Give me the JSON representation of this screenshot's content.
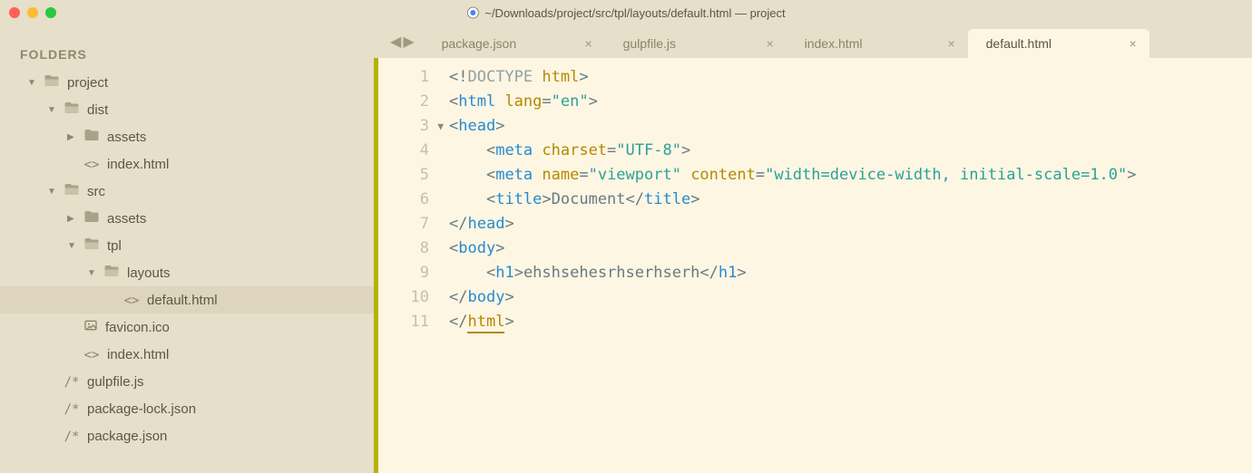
{
  "titlebar": {
    "path": "~/Downloads/project/src/tpl/layouts/default.html — project"
  },
  "sidebar": {
    "title": "FOLDERS",
    "tree": [
      {
        "depth": 0,
        "type": "folder",
        "open": true,
        "name": "project"
      },
      {
        "depth": 1,
        "type": "folder",
        "open": true,
        "name": "dist"
      },
      {
        "depth": 2,
        "type": "folder",
        "open": false,
        "name": "assets"
      },
      {
        "depth": 2,
        "type": "file",
        "icon": "code",
        "name": "index.html"
      },
      {
        "depth": 1,
        "type": "folder",
        "open": true,
        "name": "src"
      },
      {
        "depth": 2,
        "type": "folder",
        "open": false,
        "name": "assets"
      },
      {
        "depth": 2,
        "type": "folder",
        "open": true,
        "name": "tpl"
      },
      {
        "depth": 3,
        "type": "folder",
        "open": true,
        "name": "layouts"
      },
      {
        "depth": 4,
        "type": "file",
        "icon": "code",
        "name": "default.html",
        "selected": true
      },
      {
        "depth": 2,
        "type": "file",
        "icon": "image",
        "name": "favicon.ico"
      },
      {
        "depth": 2,
        "type": "file",
        "icon": "code",
        "name": "index.html"
      },
      {
        "depth": 1,
        "type": "file",
        "icon": "comment",
        "name": "gulpfile.js"
      },
      {
        "depth": 1,
        "type": "file",
        "icon": "comment",
        "name": "package-lock.json"
      },
      {
        "depth": 1,
        "type": "file",
        "icon": "comment",
        "name": "package.json"
      }
    ]
  },
  "tabs": [
    {
      "label": "package.json",
      "active": false
    },
    {
      "label": "gulpfile.js",
      "active": false
    },
    {
      "label": "index.html",
      "active": false
    },
    {
      "label": "default.html",
      "active": true
    }
  ],
  "code": {
    "fold_line": 3,
    "line_count": 11,
    "tokens": [
      [
        [
          "punct",
          "<!"
        ],
        [
          "doc",
          "DOCTYPE "
        ],
        [
          "attr",
          "html"
        ],
        [
          "punct",
          ">"
        ]
      ],
      [
        [
          "punct",
          "<"
        ],
        [
          "tag",
          "html "
        ],
        [
          "attr",
          "lang"
        ],
        [
          "punct",
          "="
        ],
        [
          "str",
          "\"en\""
        ],
        [
          "punct",
          ">"
        ]
      ],
      [
        [
          "punct",
          "<"
        ],
        [
          "tag",
          "head"
        ],
        [
          "punct",
          ">"
        ]
      ],
      [
        [
          "text",
          "    "
        ],
        [
          "punct",
          "<"
        ],
        [
          "tag",
          "meta "
        ],
        [
          "attr",
          "charset"
        ],
        [
          "punct",
          "="
        ],
        [
          "str",
          "\"UTF-8\""
        ],
        [
          "punct",
          ">"
        ]
      ],
      [
        [
          "text",
          "    "
        ],
        [
          "punct",
          "<"
        ],
        [
          "tag",
          "meta "
        ],
        [
          "attr",
          "name"
        ],
        [
          "punct",
          "="
        ],
        [
          "str",
          "\"viewport\""
        ],
        [
          "attr",
          " content"
        ],
        [
          "punct",
          "="
        ],
        [
          "str",
          "\"width=device-width, initial-scale=1.0\""
        ],
        [
          "punct",
          ">"
        ]
      ],
      [
        [
          "text",
          "    "
        ],
        [
          "punct",
          "<"
        ],
        [
          "tag",
          "title"
        ],
        [
          "punct",
          ">"
        ],
        [
          "text",
          "Document"
        ],
        [
          "punct",
          "</"
        ],
        [
          "tag",
          "title"
        ],
        [
          "punct",
          ">"
        ]
      ],
      [
        [
          "punct",
          "</"
        ],
        [
          "tag",
          "head"
        ],
        [
          "punct",
          ">"
        ]
      ],
      [
        [
          "punct",
          "<"
        ],
        [
          "tag",
          "body"
        ],
        [
          "punct",
          ">"
        ]
      ],
      [
        [
          "text",
          "    "
        ],
        [
          "punct",
          "<"
        ],
        [
          "tag",
          "h1"
        ],
        [
          "punct",
          ">"
        ],
        [
          "text",
          "ehshsehesrhserhserh"
        ],
        [
          "punct",
          "</"
        ],
        [
          "tag",
          "h1"
        ],
        [
          "punct",
          ">"
        ]
      ],
      [
        [
          "punct",
          "</"
        ],
        [
          "tag",
          "body"
        ],
        [
          "punct",
          ">"
        ]
      ],
      [
        [
          "punct",
          "</"
        ],
        [
          "name-html",
          "html"
        ],
        [
          "punct",
          ">"
        ]
      ]
    ]
  }
}
